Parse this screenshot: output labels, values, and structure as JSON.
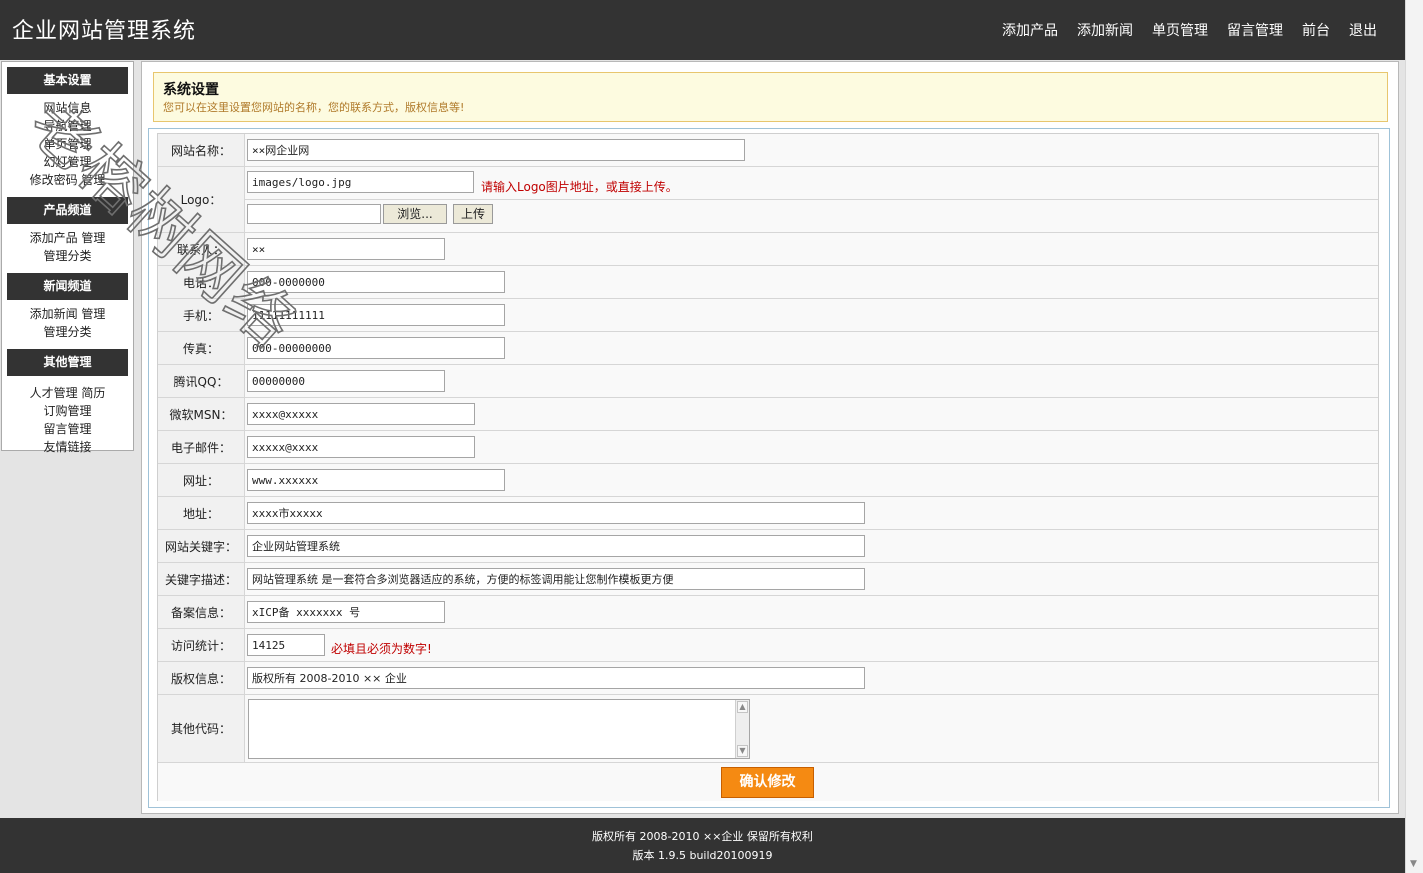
{
  "header": {
    "title": "企业网站管理系统",
    "nav": [
      "添加产品",
      "添加新闻",
      "单页管理",
      "留言管理",
      "前台",
      "退出"
    ]
  },
  "sidebar": {
    "sections": [
      {
        "title": "基本设置",
        "lines": [
          [
            "网站信息"
          ],
          [
            "导航管理"
          ],
          [
            "单页管理"
          ],
          [
            "幻灯管理"
          ],
          [
            "修改密码",
            "管理"
          ]
        ]
      },
      {
        "title": "产品频道",
        "lines": [
          [
            "添加产品",
            "管理"
          ],
          [
            "管理分类"
          ]
        ]
      },
      {
        "title": "新闻频道",
        "lines": [
          [
            "添加新闻",
            "管理"
          ],
          [
            "管理分类"
          ]
        ]
      },
      {
        "title": "其他管理",
        "lines": [
          [
            "人才管理",
            "简历"
          ],
          [
            "订购管理"
          ],
          [
            "留言管理"
          ],
          [
            "友情链接"
          ]
        ]
      }
    ]
  },
  "notice": {
    "title": "系统设置",
    "subtitle": "您可以在这里设置您网站的名称，您的联系方式，版权信息等!"
  },
  "form": {
    "site_name": {
      "label": "网站名称：",
      "value": "××网企业网"
    },
    "logo": {
      "label": "Logo：",
      "value": "images/logo.jpg",
      "hint": "请输入Logo图片地址，或直接上传。",
      "browse": "浏览...",
      "upload": "上传"
    },
    "contact": {
      "label": "联系人：",
      "value": "××"
    },
    "phone": {
      "label": "电话：",
      "value": "000-0000000"
    },
    "mobile": {
      "label": "手机：",
      "value": "11111111111"
    },
    "fax": {
      "label": "传真：",
      "value": "000-00000000"
    },
    "qq": {
      "label": "腾讯QQ：",
      "value": "00000000"
    },
    "msn": {
      "label": "微软MSN：",
      "value": "xxxx@xxxxx"
    },
    "email": {
      "label": "电子邮件：",
      "value": "xxxxx@xxxx"
    },
    "url": {
      "label": "网址：",
      "value": "www.xxxxxx"
    },
    "address": {
      "label": "地址：",
      "value": "xxxx市xxxxx"
    },
    "keywords": {
      "label": "网站关键字：",
      "value": "企业网站管理系统"
    },
    "description": {
      "label": "关键字描述：",
      "value": "网站管理系统 是一套符合多浏览器适应的系统，方便的标签调用能让您制作模板更方便"
    },
    "icp": {
      "label": "备案信息：",
      "value": "xICP备 xxxxxxx 号"
    },
    "visits": {
      "label": "访问统计：",
      "value": "14125",
      "hint": "必填且必须为数字!"
    },
    "copyright": {
      "label": "版权信息：",
      "value": "版权所有 2008-2010 ×× 企业"
    },
    "other_code": {
      "label": "其他代码：",
      "value": ""
    },
    "submit": "确认修改"
  },
  "footer": {
    "line1": "版权所有 2008-2010 ××企业 保留所有权利",
    "line2": "版本 1.9.5 build20100919"
  },
  "watermark": {
    "text": "老榕树网络"
  },
  "colors": {
    "dark_bar": "#333333",
    "page_bg": "#e4e4e4",
    "accent_orange": "#f58a12",
    "hint_red": "#c00000",
    "notice_bg": "#fdfbe0"
  }
}
